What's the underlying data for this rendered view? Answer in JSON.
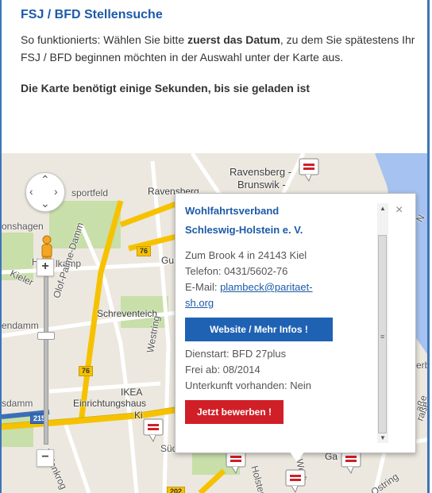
{
  "header": {
    "title": "FSJ / BFD Stellensuche",
    "desc_prefix": "So funktionierts: Wählen Sie bitte ",
    "desc_bold": "zuerst das Datum",
    "desc_suffix": ", zu dem Sie spätestens Ihr FSJ / BFD beginnen möchten in der Auswahl unter der Karte aus.",
    "note": "Die Karte benötigt einige Sekunden, bis sie geladen ist"
  },
  "map": {
    "labels": {
      "ravensberg": "Ravensberg",
      "ravensberg_brunswik": "Ravensberg -",
      "brunswik": "Brunswik -",
      "sportfeld": "sportfeld",
      "onshagen": "onshagen",
      "holkamp": "Ha",
      "holkamp2": "lkamp",
      "kieler": "Kieler",
      "schreventeich": "Schreventeich",
      "endamm": "endamm",
      "olof": "Olof-Palme-Damm",
      "westring": "Westring",
      "ikea": "IKEA",
      "einrichtungshaus": "Einrichtungshaus",
      "ki": "Ki",
      "sdamm": "sdamm",
      "uhlenkrog": "Uhlenkrog",
      "sudfriedhof": "Südfriedhof",
      "gu": "Gu",
      "ga": "Ga",
      "erbe": "erbe",
      "ostring": "Ostring",
      "hoistenre": "Holsten",
      "werft": "Werft",
      "strasse": "aße",
      "rasse": "raße",
      "ntu": "N",
      "road_76a": "76",
      "road_76b": "76",
      "road_215": "215",
      "road_202": "202"
    },
    "colors": {
      "water": "#a5c2f0",
      "land": "#ece8df",
      "green": "#c8dfa9",
      "highway": "#f6c200",
      "road": "#ffffff",
      "marker_red": "#d11f27"
    }
  },
  "popup": {
    "org_line1": "Wohlfahrtsverband",
    "org_line2": "Schleswig-Holstein e. V.",
    "address": "Zum Brook 4 in 24143 Kiel",
    "phone": "Telefon: 0431/5602-76",
    "email_label": "E-Mail: ",
    "email_line1": "plambeck@paritaet-",
    "email_line2": "sh.org",
    "website_button": "Website / Mehr Infos !",
    "dienstart": "Dienstart: BFD 27plus",
    "frei_ab": "Frei ab: 08/2014",
    "unterkunft": "Unterkunft vorhanden: Nein",
    "apply_button": "Jetzt bewerben !",
    "close_icon": "×"
  }
}
